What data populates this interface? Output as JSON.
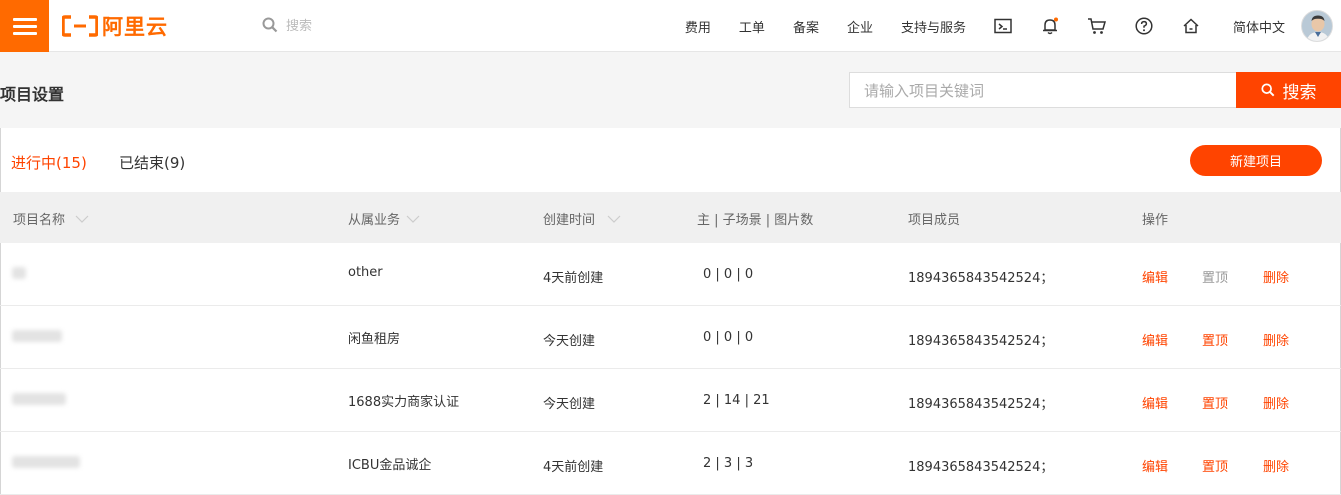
{
  "topbar": {
    "logo_text": "阿里云",
    "search_placeholder": "搜索",
    "nav_items": [
      "费用",
      "工单",
      "备案",
      "企业",
      "支持与服务"
    ],
    "icons": [
      "terminal-icon",
      "bell-icon",
      "cart-icon",
      "help-icon",
      "home-icon"
    ],
    "language": "简体中文"
  },
  "page": {
    "title": "项目设置",
    "search_placeholder": "请输入项目关键词",
    "search_button": "搜索"
  },
  "tabs": {
    "active": "进行中(15)",
    "other": "已结束(9)",
    "new_button": "新建项目"
  },
  "table": {
    "headers": [
      "项目名称",
      "从属业务",
      "创建时间",
      "主 | 子场景 | 图片数",
      "项目成员",
      "操作"
    ],
    "rows": [
      {
        "business": "other",
        "created": "4天前创建",
        "counts": "0 | 0 | 0",
        "members": "1894365843542524；",
        "edit": "编辑",
        "pin": "置顶",
        "delete": "删除",
        "pin_active": false
      },
      {
        "business": "闲鱼租房",
        "created": "今天创建",
        "counts": "0 | 0 | 0",
        "members": "1894365843542524；",
        "edit": "编辑",
        "pin": "置顶",
        "delete": "删除",
        "pin_active": true
      },
      {
        "business": "1688实力商家认证",
        "created": "今天创建",
        "counts": "2 | 14 | 21",
        "members": "1894365843542524；",
        "edit": "编辑",
        "pin": "置顶",
        "delete": "删除",
        "pin_active": true
      },
      {
        "business": "ICBU金品诚企",
        "created": "4天前创建",
        "counts": "2 | 3 | 3",
        "members": "1894365843542524；",
        "edit": "编辑",
        "pin": "置顶",
        "delete": "删除",
        "pin_active": true
      }
    ]
  },
  "colors": {
    "brand": "#ff6a00",
    "accent": "#ff4400",
    "muted": "#999999"
  }
}
